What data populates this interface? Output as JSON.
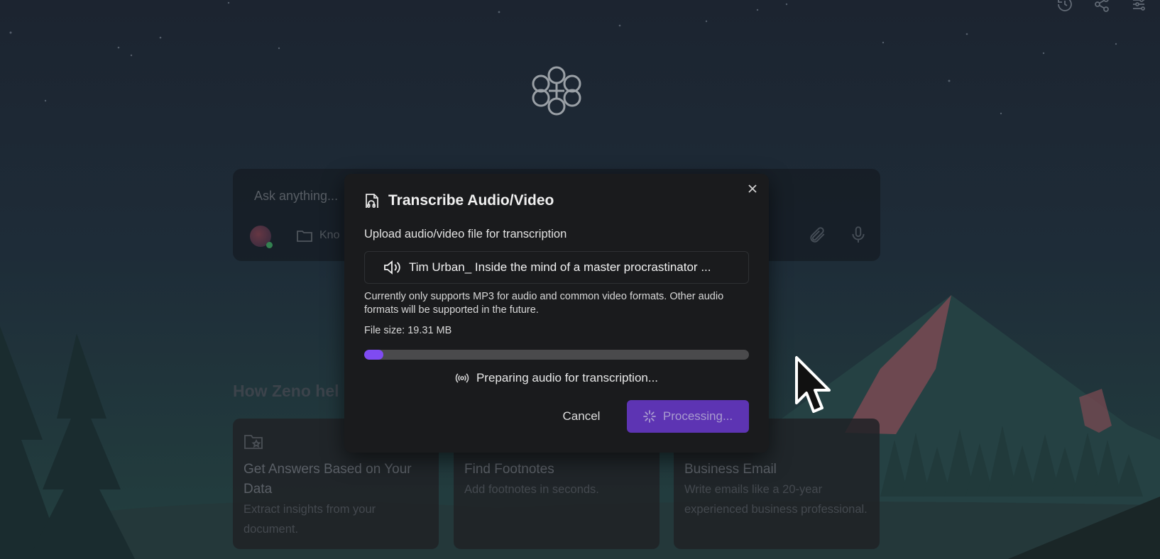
{
  "chat": {
    "placeholder": "Ask anything...",
    "knowledge_label": "Kno"
  },
  "section": {
    "title": "How Zeno hel"
  },
  "cards": [
    {
      "title": "Get Answers Based on Your Data",
      "description": "Extract insights from your document.",
      "icon": "folder-star-icon"
    },
    {
      "title": "Find Footnotes",
      "description": "Add footnotes in seconds."
    },
    {
      "title": "Business Email",
      "description": "Write emails like a 20-year experienced business professional."
    }
  ],
  "modal": {
    "title": "Transcribe Audio/Video",
    "subtitle": "Upload audio/video file for transcription",
    "file_name": "Tim Urban_ Inside the mind of a master procrastinator ...",
    "notice": "Currently only supports MP3 for audio and common video formats. Other audio formats will be supported in the future.",
    "file_size": "File size: 19.31 MB",
    "progress_percent": 5,
    "status": "Preparing audio for transcription...",
    "cancel_label": "Cancel",
    "processing_label": "Processing..."
  },
  "colors": {
    "accent": "#7f4bf2",
    "button_bg": "#5d34b3",
    "modal_bg": "#1a1b1d"
  },
  "icons": {
    "toolbar": [
      "history-icon",
      "share-icon",
      "settings-sliders-icon"
    ],
    "modal_header": "file-audio-icon",
    "file": "speaker-icon",
    "status": "broadcast-icon"
  }
}
